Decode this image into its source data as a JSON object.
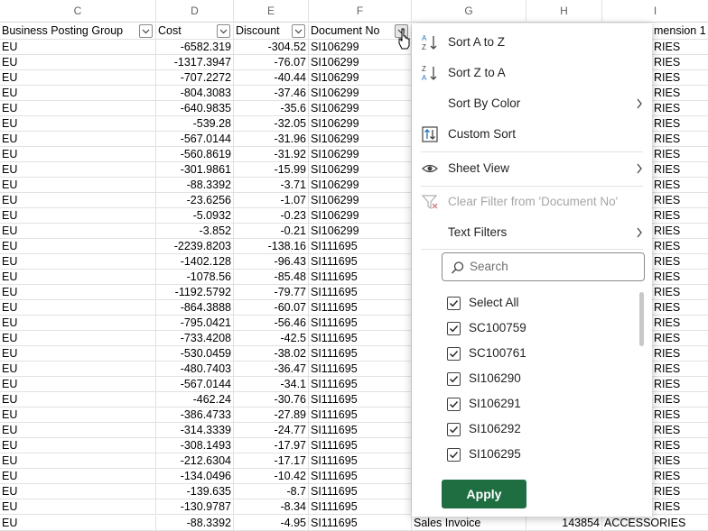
{
  "column_letters": [
    "C",
    "D",
    "E",
    "F",
    "G",
    "H",
    "I"
  ],
  "table": {
    "headers": [
      "Business Posting Group",
      "Cost",
      "Discount",
      "Document No",
      "mension 1"
    ],
    "rows": [
      [
        "EU",
        "-6582.319",
        "-304.52",
        "SI106299",
        "RIES"
      ],
      [
        "EU",
        "-1317.3947",
        "-76.07",
        "SI106299",
        "RIES"
      ],
      [
        "EU",
        "-707.2272",
        "-40.44",
        "SI106299",
        "RIES"
      ],
      [
        "EU",
        "-804.3083",
        "-37.46",
        "SI106299",
        "RIES"
      ],
      [
        "EU",
        "-640.9835",
        "-35.6",
        "SI106299",
        "RIES"
      ],
      [
        "EU",
        "-539.28",
        "-32.05",
        "SI106299",
        "RIES"
      ],
      [
        "EU",
        "-567.0144",
        "-31.96",
        "SI106299",
        "RIES"
      ],
      [
        "EU",
        "-560.8619",
        "-31.92",
        "SI106299",
        "RIES"
      ],
      [
        "EU",
        "-301.9861",
        "-15.99",
        "SI106299",
        "RIES"
      ],
      [
        "EU",
        "-88.3392",
        "-3.71",
        "SI106299",
        "RIES"
      ],
      [
        "EU",
        "-23.6256",
        "-1.07",
        "SI106299",
        "RIES"
      ],
      [
        "EU",
        "-5.0932",
        "-0.23",
        "SI106299",
        "RIES"
      ],
      [
        "EU",
        "-3.852",
        "-0.21",
        "SI106299",
        "RIES"
      ],
      [
        "EU",
        "-2239.8203",
        "-138.16",
        "SI111695",
        "RIES"
      ],
      [
        "EU",
        "-1402.128",
        "-96.43",
        "SI111695",
        "RIES"
      ],
      [
        "EU",
        "-1078.56",
        "-85.48",
        "SI111695",
        "RIES"
      ],
      [
        "EU",
        "-1192.5792",
        "-79.77",
        "SI111695",
        "RIES"
      ],
      [
        "EU",
        "-864.3888",
        "-60.07",
        "SI111695",
        "RIES"
      ],
      [
        "EU",
        "-795.0421",
        "-56.46",
        "SI111695",
        "RIES"
      ],
      [
        "EU",
        "-733.4208",
        "-42.5",
        "SI111695",
        "RIES"
      ],
      [
        "EU",
        "-530.0459",
        "-38.02",
        "SI111695",
        "RIES"
      ],
      [
        "EU",
        "-480.7403",
        "-36.47",
        "SI111695",
        "RIES"
      ],
      [
        "EU",
        "-567.0144",
        "-34.1",
        "SI111695",
        "RIES"
      ],
      [
        "EU",
        "-462.24",
        "-30.76",
        "SI111695",
        "RIES"
      ],
      [
        "EU",
        "-386.4733",
        "-27.89",
        "SI111695",
        "RIES"
      ],
      [
        "EU",
        "-314.3339",
        "-24.77",
        "SI111695",
        "RIES"
      ],
      [
        "EU",
        "-308.1493",
        "-17.97",
        "SI111695",
        "RIES"
      ],
      [
        "EU",
        "-212.6304",
        "-17.17",
        "SI111695",
        "RIES"
      ],
      [
        "EU",
        "-134.0496",
        "-10.42",
        "SI111695",
        "RIES"
      ],
      [
        "EU",
        "-139.635",
        "-8.7",
        "SI111695",
        "RIES"
      ],
      [
        "EU",
        "-130.9787",
        "-8.34",
        "SI111695",
        "RIES"
      ]
    ],
    "last_row": {
      "c": "EU",
      "d": "-88.3392",
      "e": "-4.95",
      "f": "SI111695",
      "g": "Sales Invoice",
      "h": "143854",
      "i": "ACCESSORIES"
    }
  },
  "menu": {
    "sort_az": "Sort A to Z",
    "sort_za": "Sort Z to A",
    "sort_by_color": "Sort By Color",
    "custom_sort": "Custom Sort",
    "sheet_view": "Sheet View",
    "clear_filter": "Clear Filter from 'Document No'",
    "text_filters": "Text Filters",
    "search_placeholder": "Search",
    "items": [
      "Select All",
      "SC100759",
      "SC100761",
      "SI106290",
      "SI106291",
      "SI106292",
      "SI106295"
    ],
    "apply": "Apply"
  },
  "colors": {
    "apply_bg": "#1e6e42",
    "gridline": "#e1e1e1"
  }
}
